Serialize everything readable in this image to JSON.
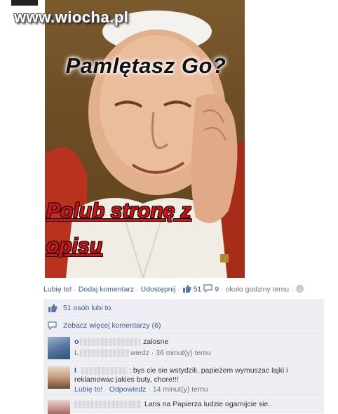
{
  "watermark": "www.wiocha.pl",
  "post": {
    "caption_top": "Pamlętasz Go?",
    "caption_bottom_1": "Polub stronę z",
    "caption_bottom_2": "opisu"
  },
  "actions": {
    "like": "Lubię to!",
    "comment": "Dodaj komentarz",
    "share": "Udostępnij",
    "like_count": "51",
    "comment_count": "9",
    "time": "około godziny temu"
  },
  "feedback": {
    "likes_text": "51 osób lubi to.",
    "more_comments": "Zobacz więcej komentarzy (6)"
  },
  "comments": [
    {
      "name_prefix": "o",
      "text": "zalosne",
      "meta_prefix": "L",
      "meta_suffix": "wiedz · 36 minut(y) temu"
    },
    {
      "name_prefix": "I",
      "text_line1": ": bys cie sie wstydzili, papieżem wymuszac lajki i",
      "text_line2": "reklamowac jakies buty, chore!!!",
      "like": "Lubię to!",
      "reply": "Odpowiedz",
      "time": "14 minut(y) temu"
    },
    {
      "text": "Lans na Papierza ludzie ogarnijcie sie.."
    }
  ],
  "colors": {
    "link": "#3b5998",
    "box_bg": "#edeff4",
    "caption_red": "#d61010"
  }
}
